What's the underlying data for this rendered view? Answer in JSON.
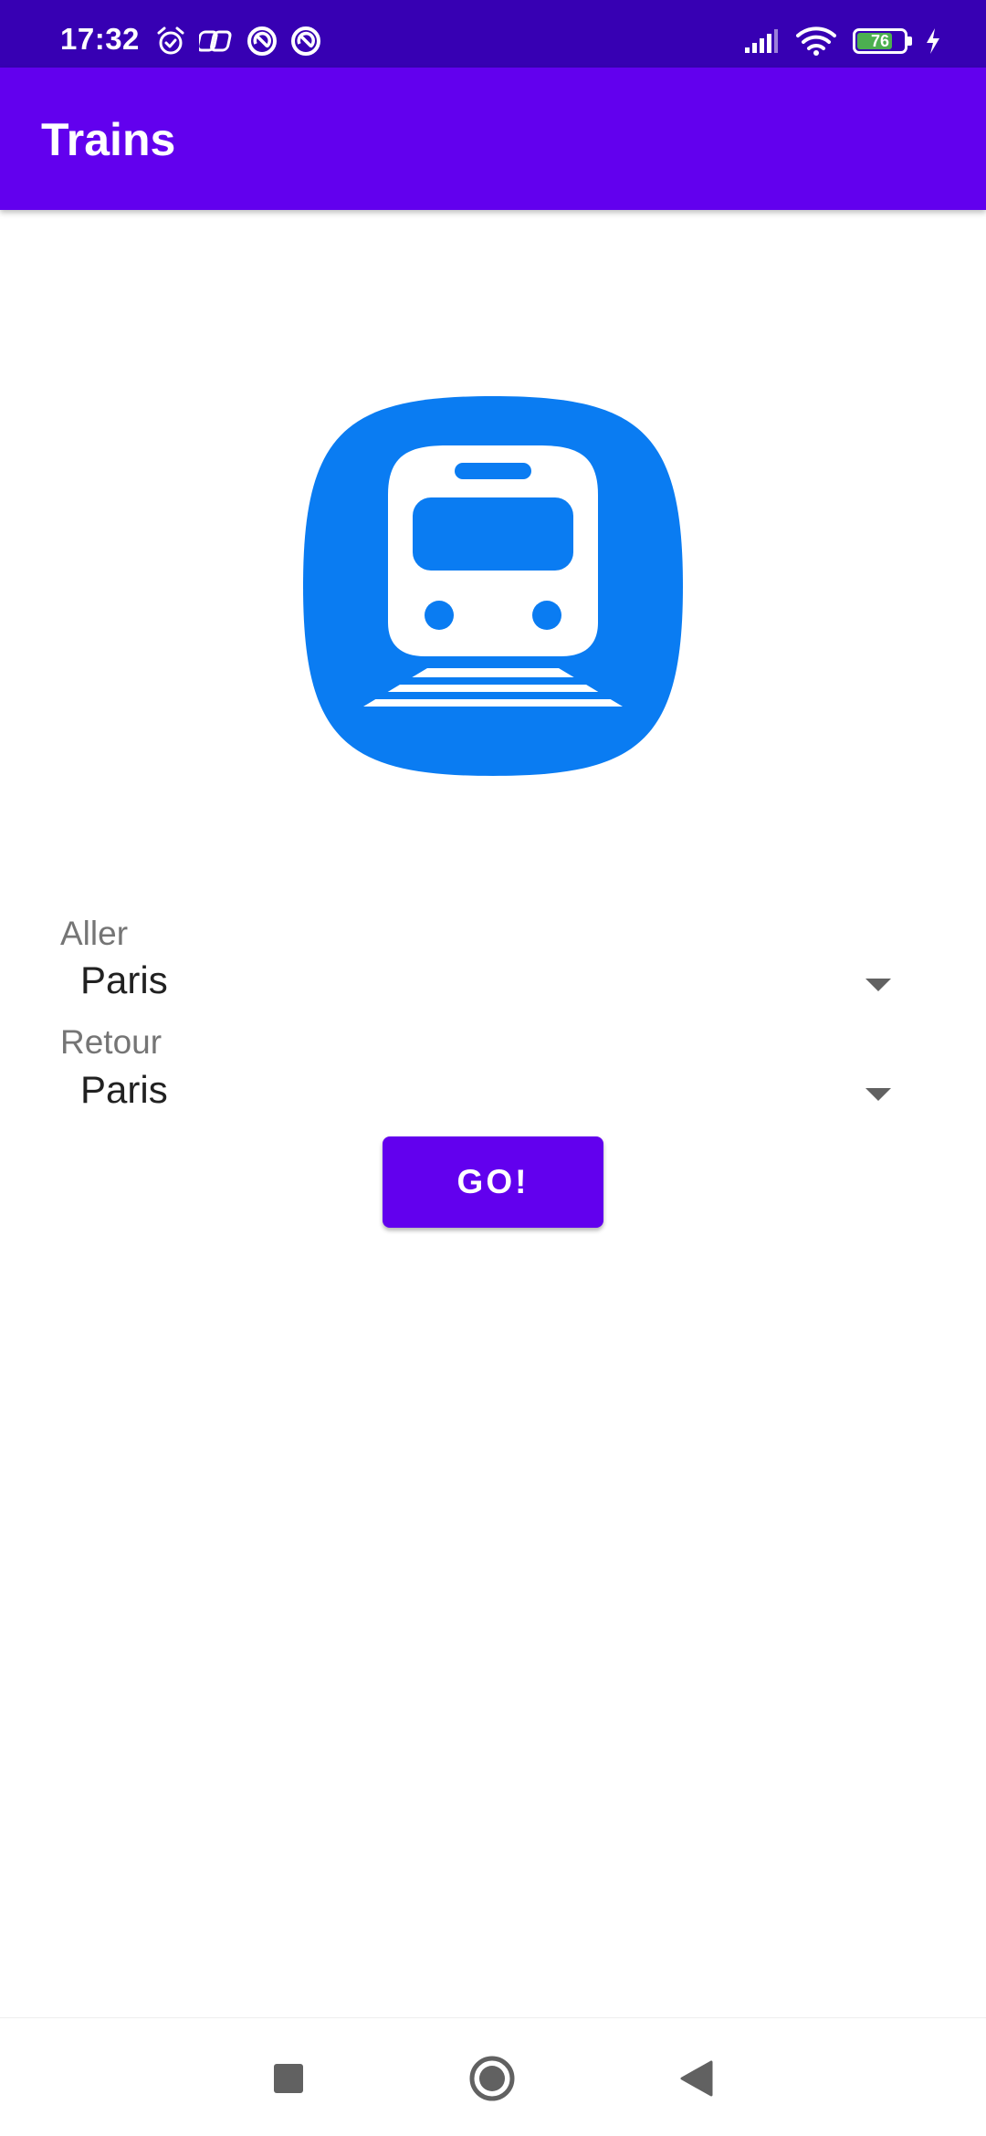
{
  "status_bar": {
    "time": "17:32",
    "battery_level": "76",
    "battery_fraction": 0.76,
    "icons_left": [
      "alarm-icon",
      "link-icon",
      "sync-icon",
      "sync-icon"
    ],
    "icons_right": [
      "cellular-signal-icon",
      "wifi-icon",
      "battery-icon",
      "charging-icon"
    ]
  },
  "app_bar": {
    "title": "Trains"
  },
  "logo": {
    "icon": "train-icon",
    "color": "#0a7cf2"
  },
  "form": {
    "aller": {
      "label": "Aller",
      "value": "Paris"
    },
    "retour": {
      "label": "Retour",
      "value": "Paris"
    },
    "submit_label": "GO!"
  },
  "nav_bar": {
    "buttons": [
      "recents-button",
      "home-button",
      "back-button"
    ]
  },
  "colors": {
    "status_bar": "#3700b3",
    "primary": "#6200ee",
    "logo_blue": "#0a7cf2"
  }
}
